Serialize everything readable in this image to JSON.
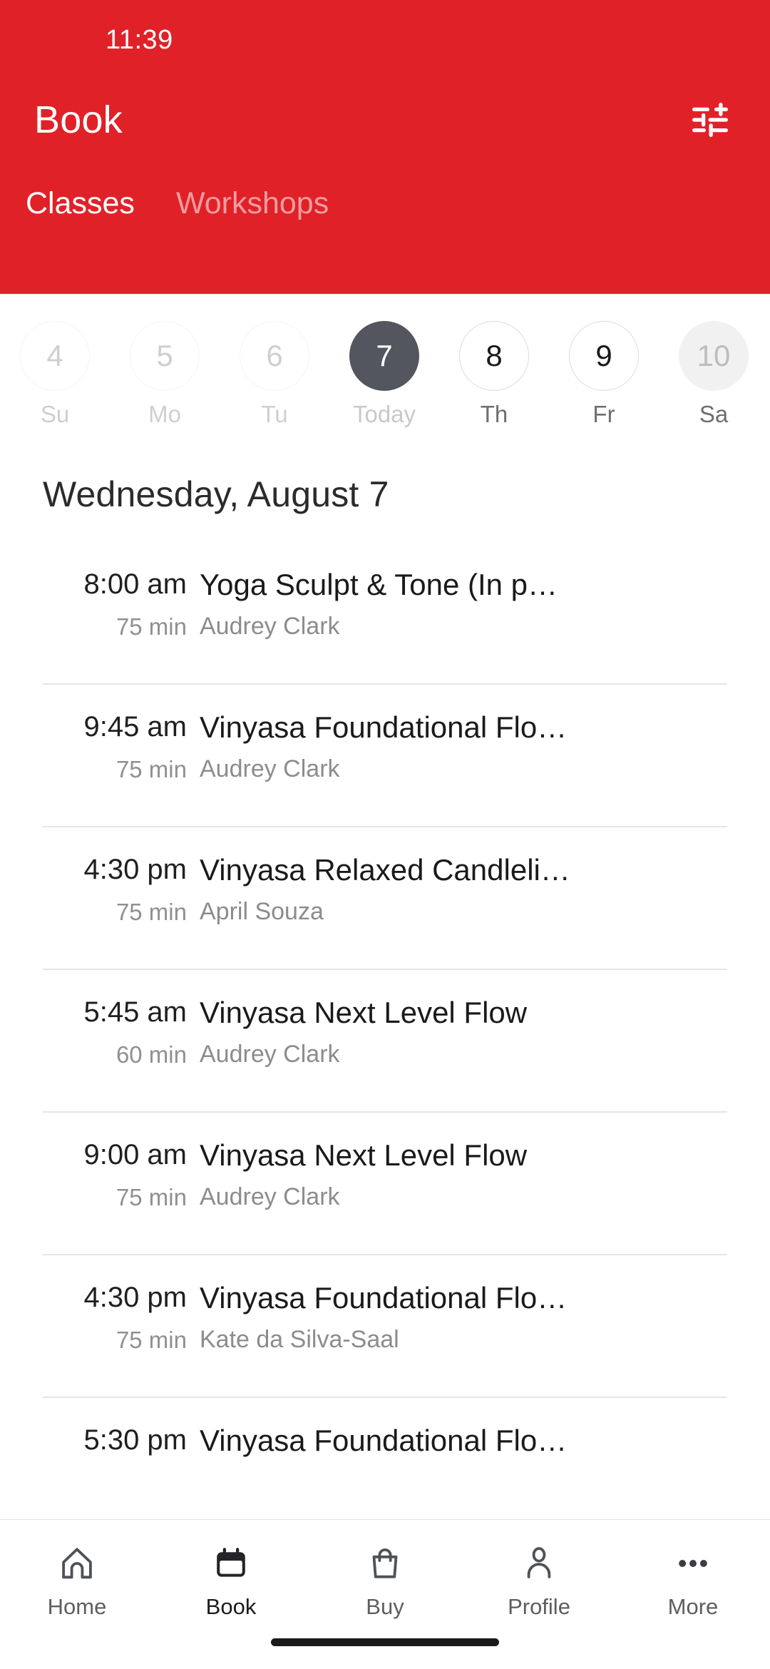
{
  "theme": {
    "brand_red": "#e02128",
    "selected_date_bg": "#53565e",
    "inactive_tab": "#f29ba0"
  },
  "status_bar": {
    "time": "11:39"
  },
  "header": {
    "title": "Book",
    "filter_icon": "sliders-icon",
    "tabs": [
      {
        "label": "Classes",
        "active": true
      },
      {
        "label": "Workshops",
        "active": false
      }
    ]
  },
  "date_strip": {
    "days": [
      {
        "date": "4",
        "weekday": "Su",
        "state": "disabled"
      },
      {
        "date": "5",
        "weekday": "Mo",
        "state": "disabled"
      },
      {
        "date": "6",
        "weekday": "Tu",
        "state": "disabled"
      },
      {
        "date": "7",
        "weekday": "Today",
        "state": "selected"
      },
      {
        "date": "8",
        "weekday": "Th",
        "state": "normal"
      },
      {
        "date": "9",
        "weekday": "Fr",
        "state": "normal"
      },
      {
        "date": "10",
        "weekday": "Sa",
        "state": "shaded"
      }
    ]
  },
  "schedule": {
    "day_heading": "Wednesday, August 7",
    "classes": [
      {
        "time": "8:00 am",
        "duration": "75 min",
        "name": "Yoga Sculpt & Tone (In p…",
        "teacher": "Audrey Clark"
      },
      {
        "time": "9:45 am",
        "duration": "75 min",
        "name": "Vinyasa Foundational Flo…",
        "teacher": "Audrey Clark"
      },
      {
        "time": "4:30 pm",
        "duration": "75 min",
        "name": "Vinyasa Relaxed Candleli…",
        "teacher": "April Souza"
      },
      {
        "time": "5:45 am",
        "duration": "60 min",
        "name": "Vinyasa Next Level Flow",
        "teacher": "Audrey Clark"
      },
      {
        "time": "9:00 am",
        "duration": "75 min",
        "name": "Vinyasa Next Level Flow",
        "teacher": "Audrey Clark"
      },
      {
        "time": "4:30 pm",
        "duration": "75 min",
        "name": "Vinyasa Foundational Flo…",
        "teacher": "Kate da Silva-Saal"
      },
      {
        "time": "5:30 pm",
        "duration": "",
        "name": "Vinyasa Foundational Flo…",
        "teacher": ""
      }
    ]
  },
  "bottom_nav": {
    "items": [
      {
        "label": "Home",
        "icon": "home-icon",
        "active": false
      },
      {
        "label": "Book",
        "icon": "calendar-icon",
        "active": true
      },
      {
        "label": "Buy",
        "icon": "bag-icon",
        "active": false
      },
      {
        "label": "Profile",
        "icon": "person-icon",
        "active": false
      },
      {
        "label": "More",
        "icon": "ellipsis-icon",
        "active": false
      }
    ]
  }
}
